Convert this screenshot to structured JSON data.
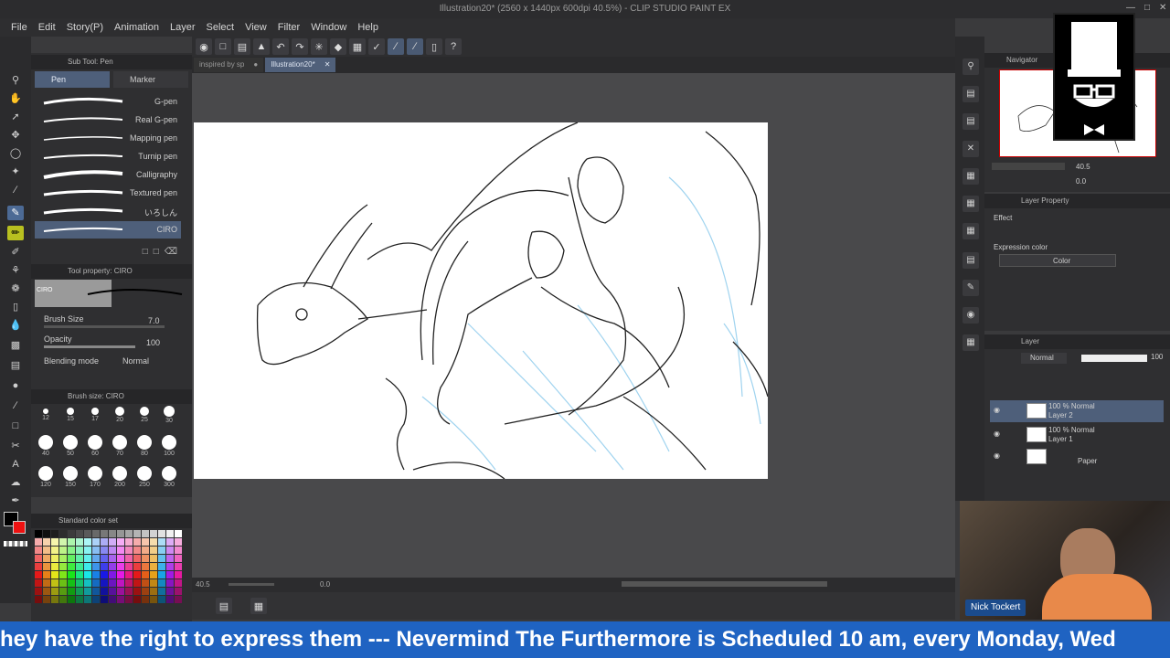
{
  "window": {
    "title": "Illustration20* (2560 x 1440px 600dpi 40.5%) - CLIP STUDIO PAINT EX"
  },
  "menu": [
    "File",
    "Edit",
    "Story(P)",
    "Animation",
    "Layer",
    "Select",
    "View",
    "Filter",
    "Window",
    "Help"
  ],
  "tabs": [
    {
      "label": "inspired by sp"
    },
    {
      "label": "Illustration20*"
    }
  ],
  "subtool": {
    "title": "Sub Tool: Pen",
    "groups": [
      "Pen",
      "Marker"
    ],
    "brushes": [
      "G-pen",
      "Real G-pen",
      "Mapping pen",
      "Turnip pen",
      "Calligraphy",
      "Textured pen",
      "いろしん",
      "CIRO"
    ]
  },
  "toolprop": {
    "title": "Tool property: CIRO",
    "preview_label": "CIRO",
    "brush_size_label": "Brush Size",
    "brush_size": "7.0",
    "opacity_label": "Opacity",
    "opacity": "100",
    "blend_label": "Blending mode",
    "blend": "Normal"
  },
  "brushsize": {
    "title": "Brush size: CIRO",
    "sizes": [
      "12",
      "15",
      "17",
      "20",
      "25",
      "30",
      "40",
      "50",
      "60",
      "70",
      "80",
      "100",
      "120",
      "150",
      "170",
      "200",
      "250",
      "300"
    ]
  },
  "palette": {
    "title": "Standard color set"
  },
  "navigator": {
    "title": "Navigator",
    "zoom": "40.5",
    "angle": "0.0"
  },
  "layerprop": {
    "title": "Layer Property",
    "effect": "Effect",
    "expr_label": "Expression color",
    "expr_value": "Color"
  },
  "layers": {
    "title": "Layer",
    "blend": "Normal",
    "opacity": "100",
    "items": [
      {
        "mode": "100 % Normal",
        "name": "Layer 2"
      },
      {
        "mode": "100 % Normal",
        "name": "Layer 1"
      },
      {
        "mode": "",
        "name": "Paper"
      }
    ]
  },
  "statusbar": {
    "zoom": "40.5",
    "angle": "0.0"
  },
  "webcam": {
    "name": "Nick Tockert"
  },
  "ticker": {
    "text": "hey have the right to express them --- Nevermind The Furthermore is Scheduled 10 am, every Monday, Wed"
  },
  "colors": {
    "accent": "#4e5f7a",
    "ticker": "#1f63c2"
  }
}
